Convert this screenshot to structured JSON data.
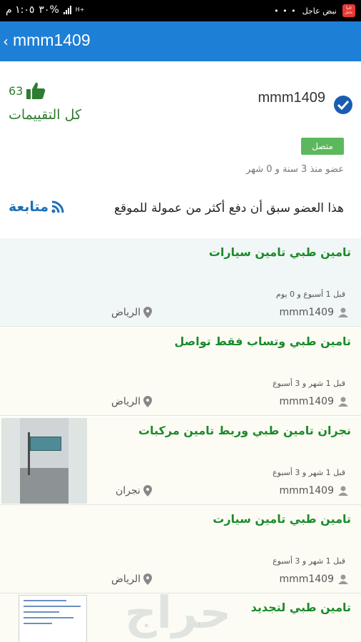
{
  "status_bar": {
    "time": "١:٠٥ م",
    "battery": "٣٠%",
    "network": "H+",
    "notification_app": "نبض عاجل",
    "app_badge": "النبأ عاجل"
  },
  "header": {
    "back_icon": "chevron-left-icon",
    "title": "mmm1409"
  },
  "profile": {
    "username": "mmm1409",
    "verified_icon": "verified-check-icon",
    "likes_count": "63",
    "likes_icon": "thumbs-up-icon",
    "all_ratings_label": "كل التقييمات",
    "status_badge": "متصل",
    "member_since": "عضو منذ 3 سنة و 0 شهر",
    "follow_label": "متابعة",
    "follow_icon": "rss-icon",
    "commission_note": "هذا العضو سبق أن دفع أكثر من عمولة للموقع"
  },
  "listings": [
    {
      "title": "تامين طبي  تامين سيارات",
      "time": "قبل 1 أسبوع و 0 يوم",
      "user": "mmm1409",
      "city": "الرياض",
      "has_image": false
    },
    {
      "title": "تامين طبي وتساب فقط تواصل",
      "time": "قبل 1 شهر و 3 أسبوع",
      "user": "mmm1409",
      "city": "الرياض",
      "has_image": false
    },
    {
      "title": "نجران تامين طبي وربط تامين مركبات",
      "time": "قبل 1 شهر و 3 أسبوع",
      "user": "mmm1409",
      "city": "نجران",
      "has_image": true
    },
    {
      "title": "تامين طبي تامين سيارت",
      "time": "قبل 1 شهر و 3 أسبوع",
      "user": "mmm1409",
      "city": "الرياض",
      "has_image": false
    },
    {
      "title": "تامين طبي لتجديد",
      "has_image": true
    }
  ],
  "watermark": "حراج",
  "colors": {
    "appbar": "#1d7fd6",
    "green_text": "#1b8a2a",
    "online_badge": "#5cb85c",
    "follow_blue": "#1d6fb8"
  }
}
